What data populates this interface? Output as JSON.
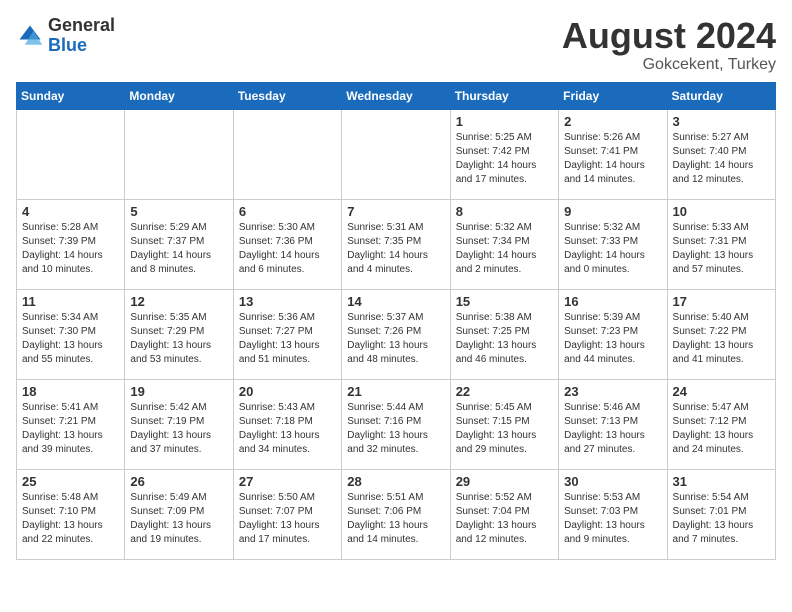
{
  "header": {
    "logo_general": "General",
    "logo_blue": "Blue",
    "month_year": "August 2024",
    "location": "Gokcekent, Turkey"
  },
  "days_of_week": [
    "Sunday",
    "Monday",
    "Tuesday",
    "Wednesday",
    "Thursday",
    "Friday",
    "Saturday"
  ],
  "weeks": [
    [
      {
        "day": "",
        "info": ""
      },
      {
        "day": "",
        "info": ""
      },
      {
        "day": "",
        "info": ""
      },
      {
        "day": "",
        "info": ""
      },
      {
        "day": "1",
        "info": "Sunrise: 5:25 AM\nSunset: 7:42 PM\nDaylight: 14 hours\nand 17 minutes."
      },
      {
        "day": "2",
        "info": "Sunrise: 5:26 AM\nSunset: 7:41 PM\nDaylight: 14 hours\nand 14 minutes."
      },
      {
        "day": "3",
        "info": "Sunrise: 5:27 AM\nSunset: 7:40 PM\nDaylight: 14 hours\nand 12 minutes."
      }
    ],
    [
      {
        "day": "4",
        "info": "Sunrise: 5:28 AM\nSunset: 7:39 PM\nDaylight: 14 hours\nand 10 minutes."
      },
      {
        "day": "5",
        "info": "Sunrise: 5:29 AM\nSunset: 7:37 PM\nDaylight: 14 hours\nand 8 minutes."
      },
      {
        "day": "6",
        "info": "Sunrise: 5:30 AM\nSunset: 7:36 PM\nDaylight: 14 hours\nand 6 minutes."
      },
      {
        "day": "7",
        "info": "Sunrise: 5:31 AM\nSunset: 7:35 PM\nDaylight: 14 hours\nand 4 minutes."
      },
      {
        "day": "8",
        "info": "Sunrise: 5:32 AM\nSunset: 7:34 PM\nDaylight: 14 hours\nand 2 minutes."
      },
      {
        "day": "9",
        "info": "Sunrise: 5:32 AM\nSunset: 7:33 PM\nDaylight: 14 hours\nand 0 minutes."
      },
      {
        "day": "10",
        "info": "Sunrise: 5:33 AM\nSunset: 7:31 PM\nDaylight: 13 hours\nand 57 minutes."
      }
    ],
    [
      {
        "day": "11",
        "info": "Sunrise: 5:34 AM\nSunset: 7:30 PM\nDaylight: 13 hours\nand 55 minutes."
      },
      {
        "day": "12",
        "info": "Sunrise: 5:35 AM\nSunset: 7:29 PM\nDaylight: 13 hours\nand 53 minutes."
      },
      {
        "day": "13",
        "info": "Sunrise: 5:36 AM\nSunset: 7:27 PM\nDaylight: 13 hours\nand 51 minutes."
      },
      {
        "day": "14",
        "info": "Sunrise: 5:37 AM\nSunset: 7:26 PM\nDaylight: 13 hours\nand 48 minutes."
      },
      {
        "day": "15",
        "info": "Sunrise: 5:38 AM\nSunset: 7:25 PM\nDaylight: 13 hours\nand 46 minutes."
      },
      {
        "day": "16",
        "info": "Sunrise: 5:39 AM\nSunset: 7:23 PM\nDaylight: 13 hours\nand 44 minutes."
      },
      {
        "day": "17",
        "info": "Sunrise: 5:40 AM\nSunset: 7:22 PM\nDaylight: 13 hours\nand 41 minutes."
      }
    ],
    [
      {
        "day": "18",
        "info": "Sunrise: 5:41 AM\nSunset: 7:21 PM\nDaylight: 13 hours\nand 39 minutes."
      },
      {
        "day": "19",
        "info": "Sunrise: 5:42 AM\nSunset: 7:19 PM\nDaylight: 13 hours\nand 37 minutes."
      },
      {
        "day": "20",
        "info": "Sunrise: 5:43 AM\nSunset: 7:18 PM\nDaylight: 13 hours\nand 34 minutes."
      },
      {
        "day": "21",
        "info": "Sunrise: 5:44 AM\nSunset: 7:16 PM\nDaylight: 13 hours\nand 32 minutes."
      },
      {
        "day": "22",
        "info": "Sunrise: 5:45 AM\nSunset: 7:15 PM\nDaylight: 13 hours\nand 29 minutes."
      },
      {
        "day": "23",
        "info": "Sunrise: 5:46 AM\nSunset: 7:13 PM\nDaylight: 13 hours\nand 27 minutes."
      },
      {
        "day": "24",
        "info": "Sunrise: 5:47 AM\nSunset: 7:12 PM\nDaylight: 13 hours\nand 24 minutes."
      }
    ],
    [
      {
        "day": "25",
        "info": "Sunrise: 5:48 AM\nSunset: 7:10 PM\nDaylight: 13 hours\nand 22 minutes."
      },
      {
        "day": "26",
        "info": "Sunrise: 5:49 AM\nSunset: 7:09 PM\nDaylight: 13 hours\nand 19 minutes."
      },
      {
        "day": "27",
        "info": "Sunrise: 5:50 AM\nSunset: 7:07 PM\nDaylight: 13 hours\nand 17 minutes."
      },
      {
        "day": "28",
        "info": "Sunrise: 5:51 AM\nSunset: 7:06 PM\nDaylight: 13 hours\nand 14 minutes."
      },
      {
        "day": "29",
        "info": "Sunrise: 5:52 AM\nSunset: 7:04 PM\nDaylight: 13 hours\nand 12 minutes."
      },
      {
        "day": "30",
        "info": "Sunrise: 5:53 AM\nSunset: 7:03 PM\nDaylight: 13 hours\nand 9 minutes."
      },
      {
        "day": "31",
        "info": "Sunrise: 5:54 AM\nSunset: 7:01 PM\nDaylight: 13 hours\nand 7 minutes."
      }
    ]
  ]
}
